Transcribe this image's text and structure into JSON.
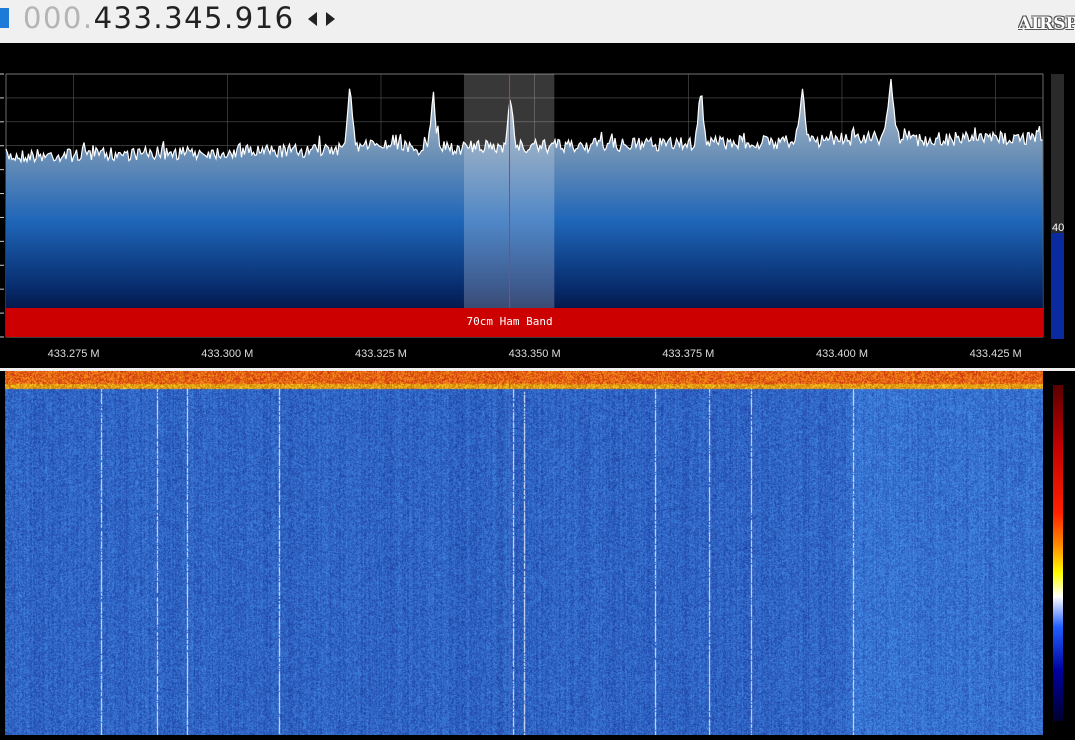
{
  "header": {
    "frequency_lead": "000.",
    "frequency_main": "433.345.916",
    "logo_text": "AIRSPY",
    "accent_color": "#1e7ad8"
  },
  "spectrum": {
    "axis_min_mhz": 433.264,
    "axis_max_mhz": 433.4327,
    "tick_labels": [
      "433.275 M",
      "433.300 M",
      "433.325 M",
      "433.350 M",
      "433.375 M",
      "433.400 M",
      "433.425 M"
    ],
    "tick_values_mhz": [
      433.275,
      433.3,
      433.325,
      433.35,
      433.375,
      433.4,
      433.425
    ],
    "tuned_mhz": 433.345916,
    "filter_low_mhz": 433.3385,
    "filter_high_mhz": 433.3532,
    "band_plan": {
      "label": "70cm Ham Band",
      "color": "#cc0000"
    },
    "gain_label": "40",
    "gain_level_fraction": 0.4,
    "peaks_mhz": [
      433.32,
      433.3335,
      433.346,
      433.377,
      433.3935,
      433.408
    ],
    "trace_color": "#ffffff",
    "fill_top_color": "#b4bcc4",
    "fill_bottom_color": "#000020"
  },
  "waterfall": {
    "colormap": [
      "#000030",
      "#0000a0",
      "#2060ff",
      "#ffffff",
      "#ffff00",
      "#ff9000",
      "#ff2000",
      "#c00000",
      "#5a0000"
    ],
    "base_color": "#1e4fc8"
  }
}
